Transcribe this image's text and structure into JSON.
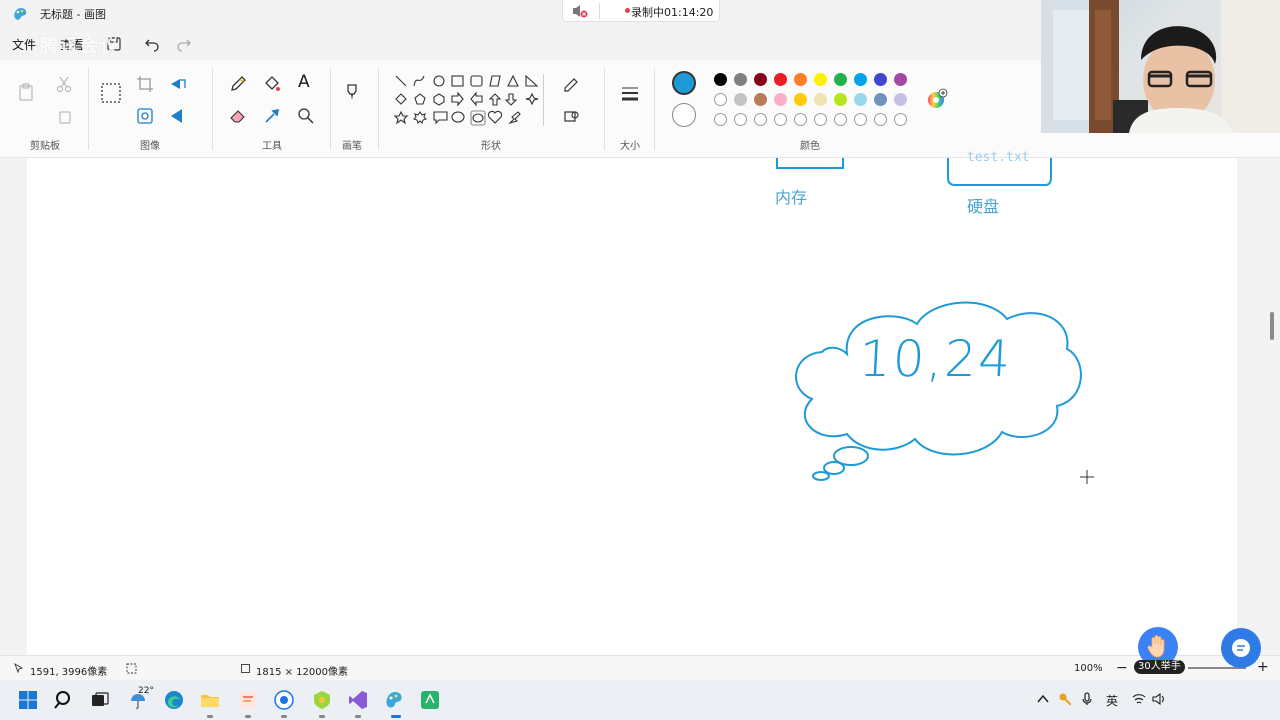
{
  "window": {
    "title": "无标题 - 画图"
  },
  "recording": {
    "label": "录制中01:14:20"
  },
  "menu": {
    "file": "文件",
    "view": "查看"
  },
  "overlay_watermark": "腾讯会议",
  "ribbon": {
    "groups": {
      "clipboard": "剪贴板",
      "image": "图像",
      "tools": "工具",
      "brushes": "画笔",
      "shapes": "形状",
      "size": "大小",
      "colors": "颜色"
    },
    "tool_text_glyph": "A",
    "primary_color": "#1e9bd7",
    "secondary_color": "#ffffff",
    "palette_row1": [
      "#000000",
      "#7f7f7f",
      "#880015",
      "#ed1c24",
      "#ff7f27",
      "#fff200",
      "#22b14c",
      "#00a2e8",
      "#3f48cc",
      "#a349a4"
    ],
    "palette_row2": [
      "#ffffff",
      "#c3c3c3",
      "#b97a57",
      "#ffaec9",
      "#ffc90e",
      "#efe4b0",
      "#b5e61d",
      "#99d9ea",
      "#7092be",
      "#c8bfe7"
    ]
  },
  "canvas": {
    "memory_label": "内存",
    "disk_label": "硬盘",
    "file_label": "test.txt",
    "bubble_text": "10,24",
    "stroke_color": "#1e9bd7"
  },
  "status": {
    "cursor_pos": "1591, 3996像素",
    "canvas_size": "1815 × 12000像素",
    "zoom": "100%"
  },
  "meeting": {
    "raise_hands": "30人举手"
  },
  "taskbar": {
    "weather_temp": "22°",
    "ime": "英"
  }
}
